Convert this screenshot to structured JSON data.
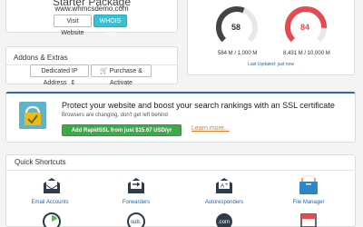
{
  "package": {
    "name": "Starter Package",
    "domain": "www.whmcsdemo.com"
  },
  "buttons": {
    "visit_website": "Visit Website",
    "whois_info": "WHOIS Info"
  },
  "addons": {
    "title": "Addons & Extras",
    "dedicated_ip": "Dedicated IP Address",
    "purchase": "Purchase & Activate"
  },
  "usage": {
    "disk": {
      "percent": "58",
      "label": "584 M / 1,000 M",
      "color": "#444444"
    },
    "bandwidth": {
      "percent": "84",
      "label": "8,431 M / 10,000 M",
      "color": "#e34b50"
    },
    "updated": "Last Updated: just now"
  },
  "ssl": {
    "title": "Protect your website and boost your search rankings with an SSL certificate",
    "subtitle": "Browsers are changing, don't get left behind",
    "button": "Add RapidSSL from just $15.67 USD/yr",
    "learn_more": "Learn more..."
  },
  "quick": {
    "title": "Quick Shortcuts",
    "items": [
      {
        "label": "Email Accounts",
        "icon": "email-icon"
      },
      {
        "label": "Forwarders",
        "icon": "forwarders-icon"
      },
      {
        "label": "Autoresponders",
        "icon": "autoresponders-icon"
      },
      {
        "label": "File Manager",
        "icon": "file-manager-icon"
      }
    ]
  },
  "colors": {
    "accent": "#2b6ca7",
    "whois": "#33c3d4",
    "ssl_green": "#3fa84b",
    "link": "#1a66b0",
    "learn_more": "#e57e22"
  }
}
